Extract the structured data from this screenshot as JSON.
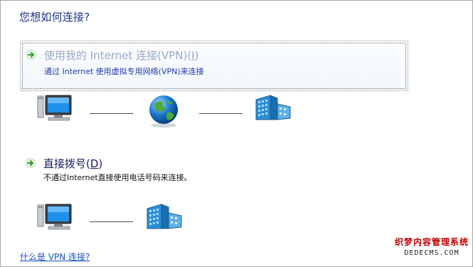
{
  "page": {
    "title": "您想如何连接?"
  },
  "options": [
    {
      "title_prefix": "使用我的 Internet 连接(VPN)(",
      "hotkey": "I",
      "title_suffix": ")",
      "description": "通过 Internet 使用虚拟专用网络(VPN)来连接",
      "selected": true
    },
    {
      "title_prefix": "直接拨号(",
      "hotkey": "D",
      "title_suffix": ")",
      "description": "不通过Internet直接使用电话号码来连接。",
      "selected": false
    }
  ],
  "icons": {
    "option_arrow": "green-arrow-icon",
    "computer": "computer-monitor-icon",
    "internet": "globe-icon",
    "network": "workplace-building-icon"
  },
  "help": {
    "link_text": "什么是 VPN 连接?"
  },
  "watermark": {
    "line1": "织梦内容管理系统",
    "line2": "DEDECMS.COM"
  },
  "colors": {
    "title": "#1e3287",
    "link": "#1550c8",
    "arrow": "#2e9a2e",
    "accent_blue": "#2a7bd0"
  }
}
